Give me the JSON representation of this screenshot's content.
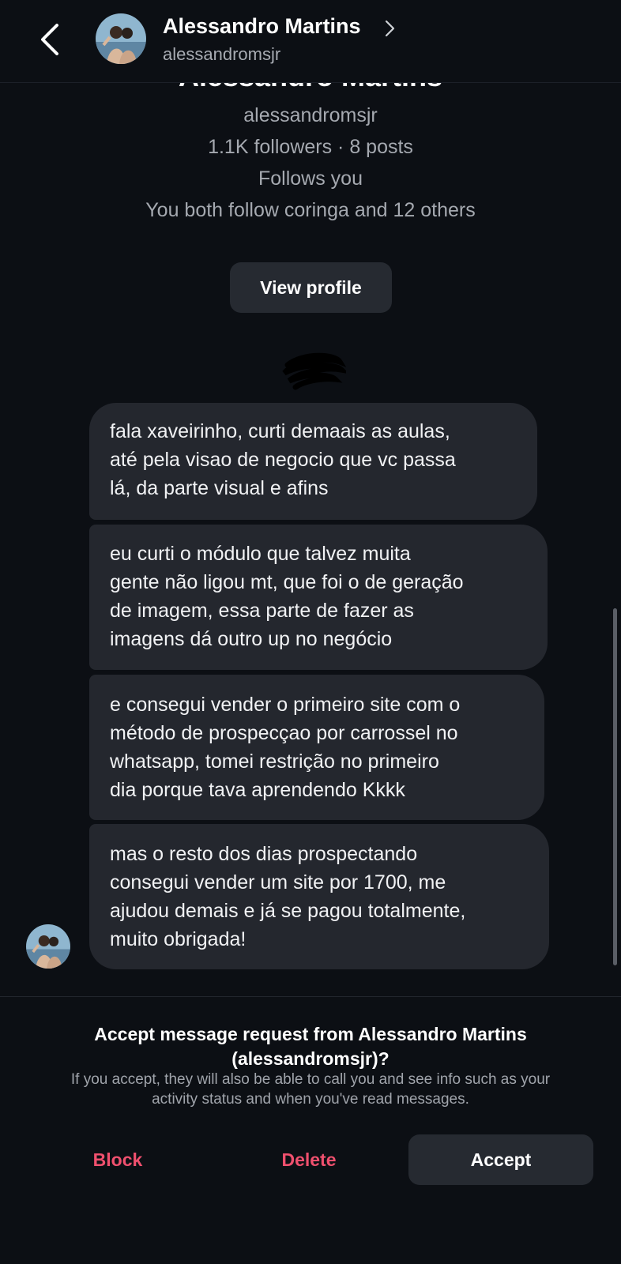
{
  "header": {
    "back_icon": "chevron-left-icon",
    "name": "Alessandro Martins",
    "name_chevron_icon": "chevron-right-icon",
    "username": "alessandromsjr",
    "avatar_icon": "profile-photo-avatar"
  },
  "profile_card": {
    "name": "Alessandro Martins",
    "username": "alessandromsjr",
    "stats": "1.1K followers · 8 posts",
    "follows_you": "Follows you",
    "mutuals": "You both follow coringa and 12 others",
    "view_profile_label": "View profile"
  },
  "messages": [
    {
      "lines": [
        "fala xaveirinho, curti demaais as aulas,",
        "até pela visao de negocio que vc passa",
        "lá, da parte visual e afins"
      ]
    },
    {
      "lines": [
        "eu curti o módulo que talvez muita",
        "gente não ligou mt, que foi o de geração",
        "de imagem, essa parte de fazer as",
        "imagens dá outro up no negócio"
      ]
    },
    {
      "lines": [
        "e consegui vender o primeiro site com o",
        "método de prospecçao por carrossel no",
        "whatsapp, tomei restrição no primeiro",
        "dia porque tava aprendendo Kkkk"
      ]
    },
    {
      "lines": [
        "mas o resto dos dias prospectando",
        "consegui vender um site por 1700, me",
        "ajudou demais e já se pagou totalmente,",
        "muito obrigada!"
      ]
    }
  ],
  "request": {
    "title_lines": [
      "Accept message request from Alessandro Martins",
      "(alessandromsjr)?"
    ],
    "desc_lines": [
      "If you accept, they will also be able to call you and see info such as your",
      "activity status and when you've read messages."
    ],
    "block_label": "Block",
    "delete_label": "Delete",
    "accept_label": "Accept"
  },
  "colors": {
    "background": "#0c0f14",
    "bubble": "#24272e",
    "button": "#262a31",
    "danger": "#f0506e",
    "secondary_text": "#a5a9b0"
  }
}
